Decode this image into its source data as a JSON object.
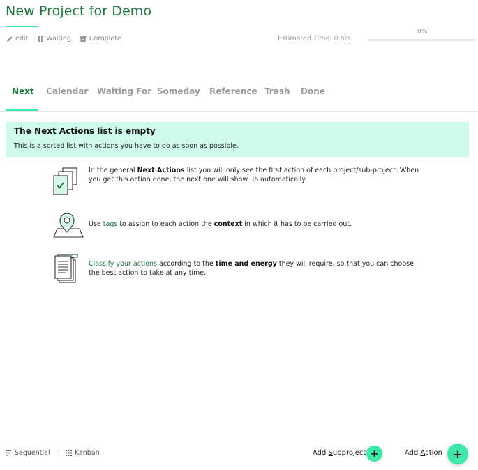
{
  "project": {
    "title": "New Project for Demo",
    "actions": [
      {
        "label": "edit",
        "icon": "pencil-icon"
      },
      {
        "label": "Waiting",
        "icon": "pause-icon"
      },
      {
        "label": "Complete",
        "icon": "archive-icon"
      }
    ],
    "estimated_time": "Estimated Time: 0 hrs",
    "progress_label": "0%",
    "progress_fraction": 0
  },
  "tabs": [
    {
      "label": "Next",
      "active": true
    },
    {
      "label": "Calendar",
      "active": false
    },
    {
      "label": "Waiting For",
      "active": false
    },
    {
      "label": "Someday",
      "active": false
    },
    {
      "label": "Reference",
      "active": false
    },
    {
      "label": "Trash",
      "active": false
    },
    {
      "label": "Done",
      "active": false
    }
  ],
  "banner": {
    "title": "The Next Actions list is empty",
    "subtitle": "This is a sorted list with actions you have to do as soon as possible."
  },
  "tips": [
    {
      "icon": "documents-check-icon",
      "parts": [
        "In the general ",
        "Next Actions",
        " list you will only see the first action of each project/sub-project. When you get this action done, the next one will show up automatically."
      ]
    },
    {
      "icon": "location-pin-icon",
      "parts": [
        "Use ",
        "tags",
        " to assign to each action the ",
        "context",
        " in which it has to be carried out."
      ]
    },
    {
      "icon": "document-stack-icon",
      "parts": [
        "Classify your actions",
        " according to the ",
        "time and energy",
        " they will require, so that you can choose the best action to take at any time."
      ]
    }
  ],
  "footer": {
    "sequential_label": "Sequential",
    "kanban_label": "Kanban",
    "separator": "|",
    "add_subproject_prefix": "Add ",
    "add_subproject_u": "S",
    "add_subproject_rest": "ubproject",
    "add_action_prefix": "Add ",
    "add_action_u": "A",
    "add_action_rest": "ction",
    "plus": "+"
  },
  "colors": {
    "accent": "#3de8a8",
    "brand_green": "#1a7a3e",
    "banner_bg": "#cffcea"
  }
}
